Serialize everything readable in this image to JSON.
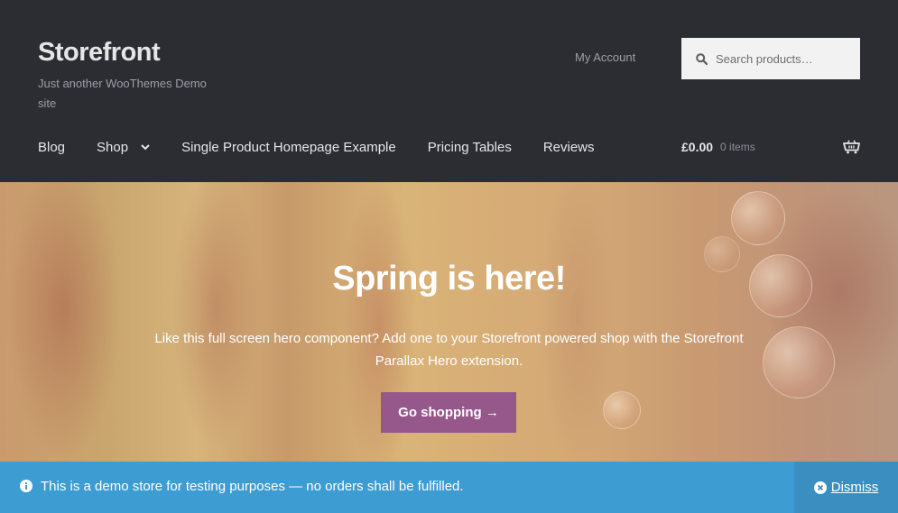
{
  "header": {
    "site_title": "Storefront",
    "tagline": "Just another WooThemes Demo site",
    "my_account": "My Account",
    "search": {
      "placeholder": "Search products…",
      "icon": "search-icon"
    }
  },
  "nav": {
    "items": [
      {
        "label": "Blog"
      },
      {
        "label": "Shop",
        "has_dropdown": true
      },
      {
        "label": "Single Product Homepage Example"
      },
      {
        "label": "Pricing Tables"
      },
      {
        "label": "Reviews"
      }
    ]
  },
  "cart": {
    "amount": "£0.00",
    "count": "0 items",
    "icon": "cart-icon"
  },
  "hero": {
    "title": "Spring is here!",
    "text": "Like this full screen hero component? Add one to your Storefront powered shop with the Storefront Parallax Hero extension.",
    "button_label": "Go shopping →"
  },
  "notice": {
    "text": "This is a demo store for testing purposes — no orders shall be fulfilled.",
    "dismiss_label": "Dismiss"
  },
  "colors": {
    "header_bg": "#2c2d33",
    "accent_button": "#96588a",
    "notice_bg": "#3d9cd2",
    "dismiss_bg": "#3a8fc0"
  }
}
